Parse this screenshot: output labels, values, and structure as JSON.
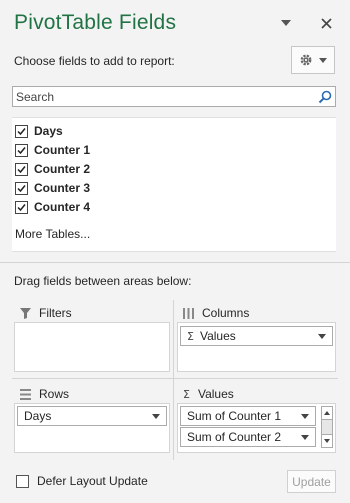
{
  "panel": {
    "title": "PivotTable Fields",
    "choose_label": "Choose fields to add to report:",
    "accent_color": "#217346"
  },
  "search": {
    "placeholder": "Search",
    "value": ""
  },
  "fields": [
    {
      "label": "Days",
      "checked": true
    },
    {
      "label": "Counter 1",
      "checked": true
    },
    {
      "label": "Counter 2",
      "checked": true
    },
    {
      "label": "Counter 3",
      "checked": true
    },
    {
      "label": "Counter 4",
      "checked": true
    }
  ],
  "more_tables": "More Tables...",
  "drag_label": "Drag fields between areas below:",
  "areas": {
    "filters": {
      "label": "Filters",
      "items": []
    },
    "columns": {
      "label": "Columns",
      "items": [
        "Values"
      ]
    },
    "rows": {
      "label": "Rows",
      "items": [
        "Days"
      ]
    },
    "values": {
      "label": "Values",
      "items": [
        "Sum of Counter 1",
        "Sum of Counter 2"
      ]
    }
  },
  "footer": {
    "defer_label": "Defer Layout Update",
    "defer_checked": false,
    "update_label": "Update"
  },
  "icons": {
    "dropdown": "chevron-down-icon",
    "close": "close-icon",
    "settings": "gear-icon",
    "search": "search-icon",
    "filter": "filter-icon",
    "columns": "columns-icon",
    "rows": "rows-icon",
    "values": "sigma-icon"
  }
}
